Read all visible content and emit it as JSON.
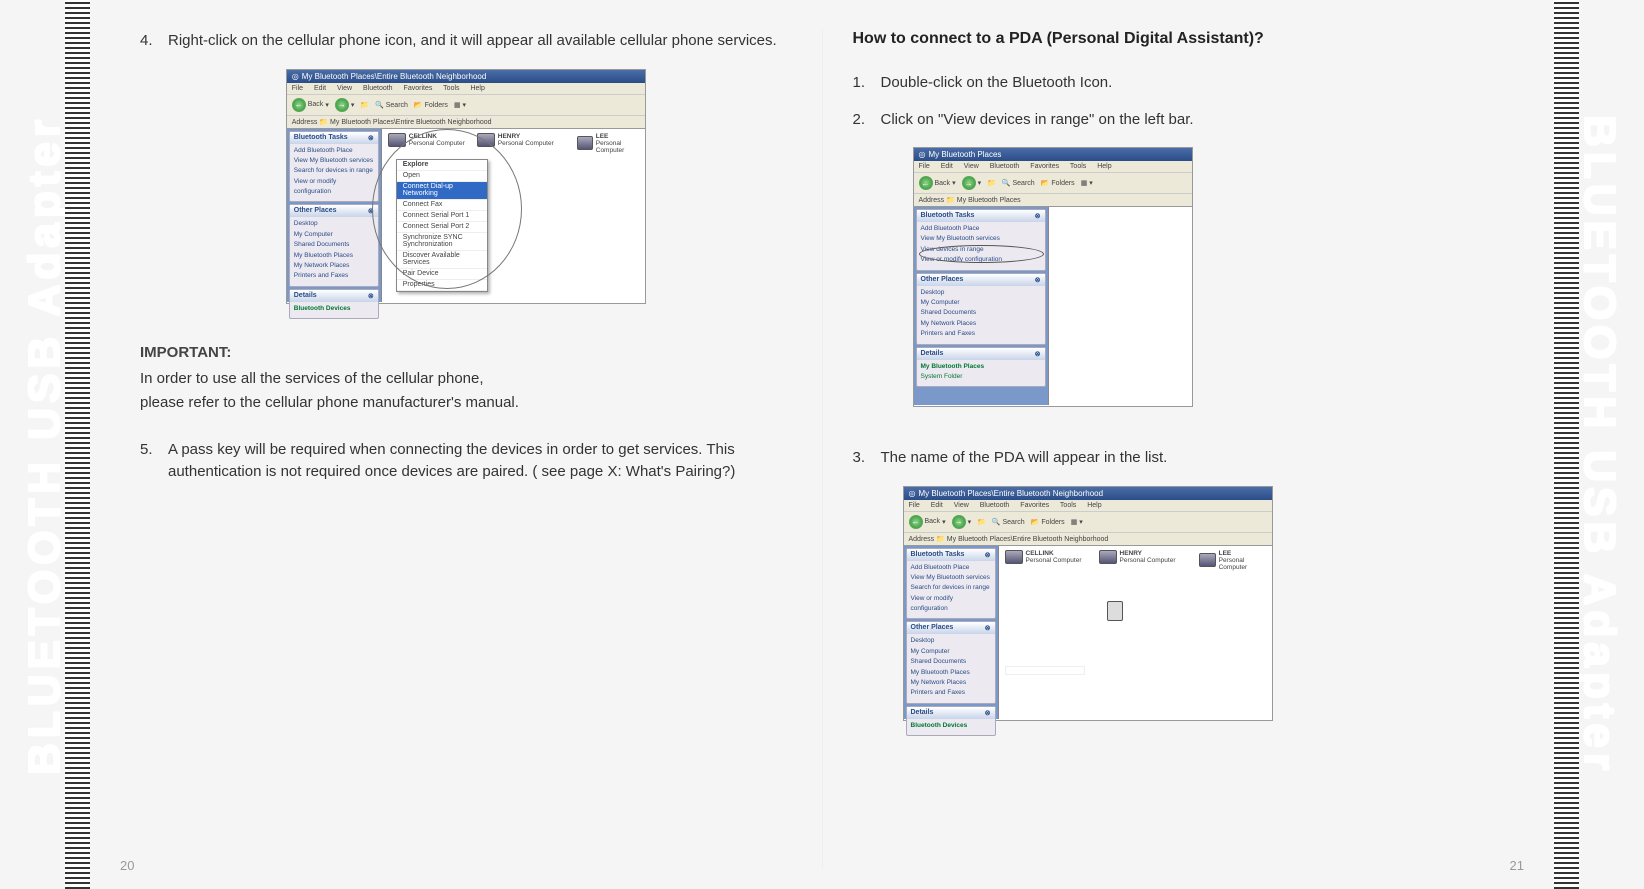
{
  "left": {
    "step4_num": "4.",
    "step4": "Right-click on the cellular phone icon, and it will appear all available cellular phone services.",
    "important_hdr": "IMPORTANT:",
    "important_body": "In order to use all the services of the cellular phone,\nplease refer to the cellular phone manufacturer's manual.",
    "step5_num": "5.",
    "step5": "A pass key will be required when connecting the devices in order to get services.  This authentication is not required once devices are paired. ( see page X:  What's Pairing?)",
    "page_num": "20"
  },
  "right": {
    "title": "How to connect to a PDA (Personal Digital Assistant)?",
    "step1_num": "1.",
    "step1": "Double-click on the Bluetooth Icon.",
    "step2_num": "2.",
    "step2": "Click on \"View devices in range\" on the left bar.",
    "step3_num": "3.",
    "step3": "The name of the PDA will appear in the list.",
    "page_num": "21"
  },
  "spine": "BLUETOOTH USB Adapter",
  "ss": {
    "title1": "My Bluetooth Places\\Entire Bluetooth Neighborhood",
    "title2": "My Bluetooth Places",
    "menu": {
      "file": "File",
      "edit": "Edit",
      "view": "View",
      "bt": "Bluetooth",
      "fav": "Favorites",
      "tools": "Tools",
      "help": "Help"
    },
    "toolbar": {
      "back": "Back",
      "search": "Search",
      "folders": "Folders"
    },
    "address_label": "Address",
    "address1": "My Bluetooth Places\\Entire Bluetooth Neighborhood",
    "address2": "My Bluetooth Places",
    "tasks_hdr": "Bluetooth Tasks",
    "tasks": [
      "Add Bluetooth Place",
      "View My Bluetooth services",
      "Search for devices in range",
      "View or modify configuration"
    ],
    "tasks2": [
      "Add Bluetooth Place",
      "View My Bluetooth services",
      "View devices in range",
      "View or modify configuration"
    ],
    "other_hdr": "Other Places",
    "other": [
      "Desktop",
      "My Computer",
      "Shared Documents",
      "My Bluetooth Places",
      "My Network Places",
      "Printers and Faxes"
    ],
    "details_hdr": "Details",
    "details1": "Bluetooth Devices",
    "details2a": "My Bluetooth Places",
    "details2b": "System Folder",
    "devices": {
      "d1_name": "CELLINK",
      "d1_sub": "Personal Computer",
      "d2_name": "HENRY",
      "d2_sub": "Personal Computer",
      "d3_name": "LEE",
      "d3_sub": "Personal Computer"
    },
    "context": {
      "explore": "Explore",
      "open": "Open",
      "c1": "Connect Dial-up Networking",
      "c2": "Connect Fax",
      "c3": "Connect Serial Port 1",
      "c4": "Connect Serial Port 2",
      "c5": "Synchronize SYNC Synchronization",
      "disc": "Discover Available Services",
      "pair": "Pair Device",
      "props": "Properties"
    }
  }
}
